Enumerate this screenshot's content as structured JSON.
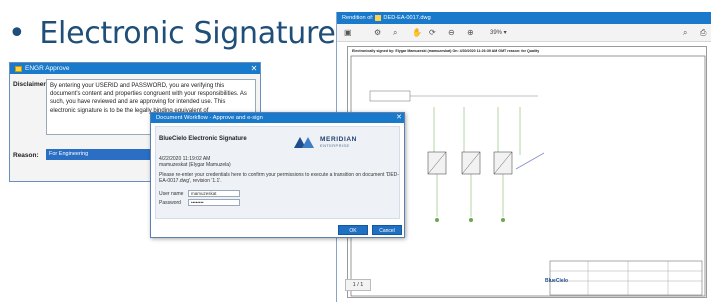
{
  "slide": {
    "bullet": "•",
    "title": "Electronic Signature"
  },
  "engr_dialog": {
    "title": "ENGR Approve",
    "close": "✕",
    "disclaimer_label": "Disclaimer:",
    "disclaimer_text": "By entering your USERID and PASSWORD, you are verifying this document's content and properties congruent with your responsibilities. As such, you have reviewed and are approving for intended use. This electronic signature is to be the legally binding equivalent of",
    "reason_label": "Reason:",
    "reason_value": "For Engineering"
  },
  "workflow_dialog": {
    "title": "Document Workflow - Approve and e-sign",
    "close": "✕",
    "signature_heading": "BlueCielo Electronic Signature",
    "brand_name": "MERIDIAN",
    "brand_sub": "ENTERPRISE",
    "date": "4/22/2020 11:19:02 AM",
    "user": "mamuzeskat (Elygar Mamuzela)",
    "instruction": "Please re-enter your credentials here to confirm your permissions to execute a transition on document 'DED-EA-0017.dwg', revision '1.1'.",
    "username_label": "User name",
    "username_value": "mamuzeskat",
    "password_label": "Password",
    "password_value": "••••••••",
    "ok_label": "OK",
    "cancel_label": "Cancel"
  },
  "viewer": {
    "title_prefix": "Rendition of:",
    "file_name": "DED-EA-0017.dwg",
    "zoom": "39%",
    "signature_line": "Electronically signed by: Elygar Mamuzeski (mamuzeskat) On: 4/30/2020 11:26:39 AM GMT reason: for Quality",
    "page_indicator": "1 / 1",
    "logo": "BlueCielo"
  },
  "colors": {
    "title_blue": "#1f4e79",
    "window_blue": "#1979ca",
    "button_blue": "#1f6fc2"
  }
}
